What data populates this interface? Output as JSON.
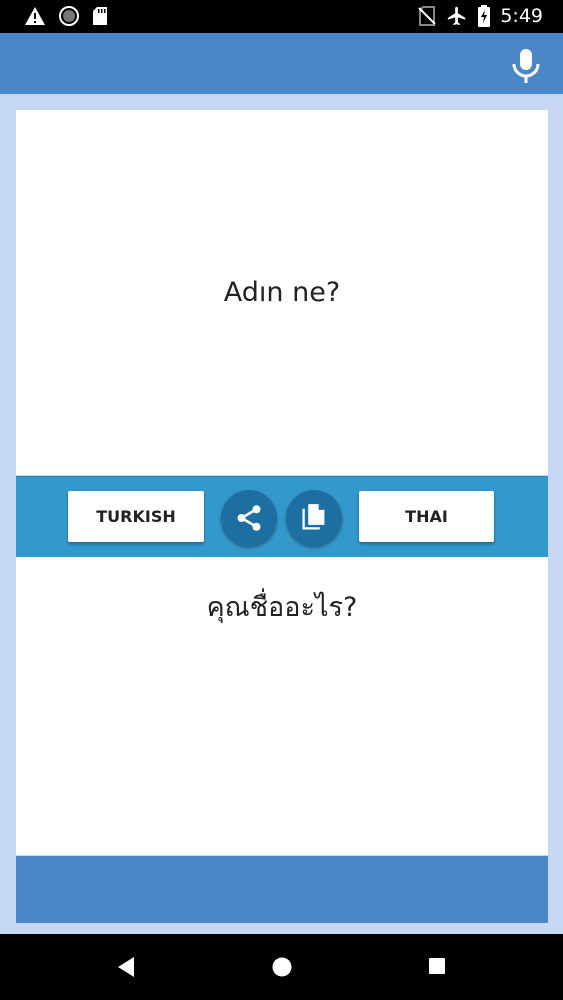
{
  "status_bar": {
    "time": "5:49",
    "icons": [
      "alert-icon",
      "sync-icon",
      "sd-card-icon",
      "no-sim-icon",
      "airplane-icon",
      "battery-charging-icon"
    ]
  },
  "app_bar": {
    "icons": [
      "microphone-icon"
    ]
  },
  "source": {
    "text": "Adın ne?"
  },
  "language_bar": {
    "source_language": "TURKISH",
    "target_language": "THAI",
    "icons": [
      "share-icon",
      "copy-icon"
    ]
  },
  "target": {
    "text": "คุณชื่ออะไร?"
  },
  "colors": {
    "app_bar": "#4b87c6",
    "language_bar": "#3399cc",
    "round_button": "#1e6fa1",
    "background": "#c5d7f3"
  },
  "nav_bar": {
    "icons": [
      "back-icon",
      "home-icon",
      "recents-icon"
    ]
  }
}
